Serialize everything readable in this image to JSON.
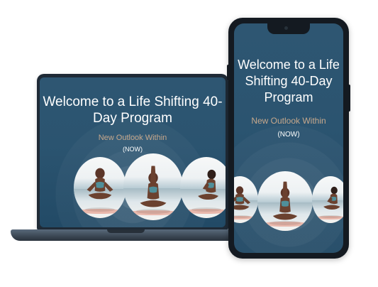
{
  "laptop": {
    "title": "Welcome to a Life Shifting 40-Day Program",
    "subtitle": "New Outlook Within",
    "tagline": "(NOW)"
  },
  "phone": {
    "title": "Welcome to a Life Shifting 40-Day Program",
    "subtitle": "New Outlook Within",
    "tagline": "(NOW)"
  }
}
